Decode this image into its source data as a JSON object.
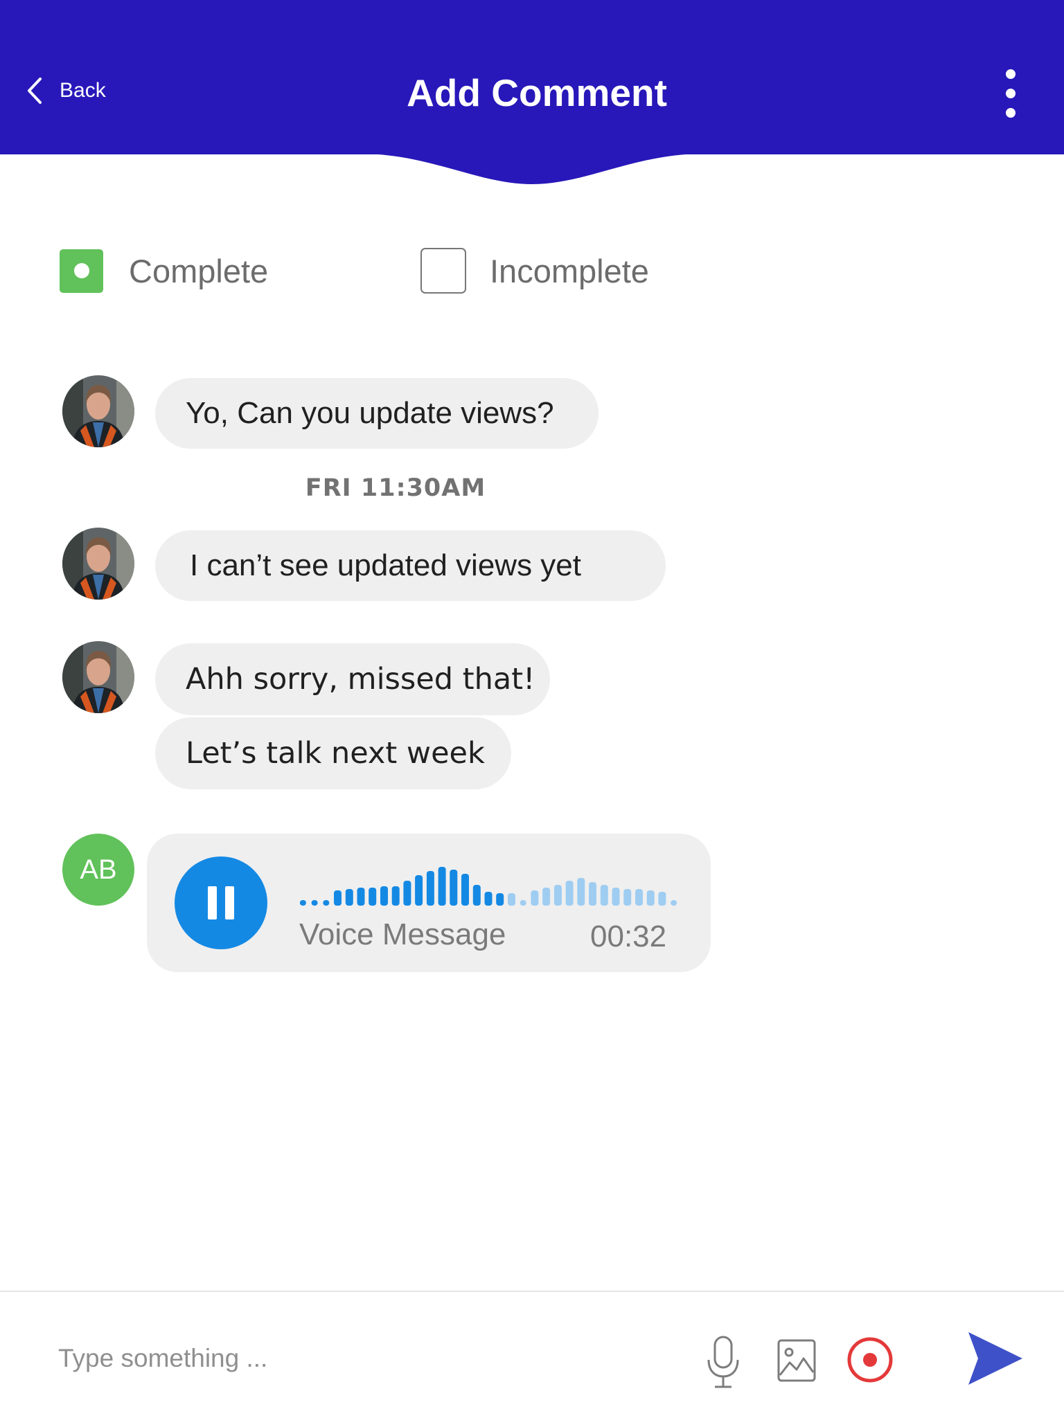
{
  "header": {
    "back_label": "Back",
    "title": "Add Comment",
    "color": "#2818b9"
  },
  "status": {
    "complete_label": "Complete",
    "incomplete_label": "Incomplete",
    "selected": "Complete"
  },
  "messages": [
    {
      "text": "Yo, Can you update views?"
    },
    {
      "timestamp": "FRI 11:30AM"
    },
    {
      "text": "I can’t see updated views yet"
    },
    {
      "text": "Ahh sorry, missed that!"
    },
    {
      "text": "Let’s talk next week"
    }
  ],
  "voice_message": {
    "sender_initials": "AB",
    "label": "Voice Message",
    "duration": "00:32",
    "state": "playing",
    "accent": "#1489e4"
  },
  "composer": {
    "placeholder": "Type something ...",
    "tools": [
      "microphone-icon",
      "image-icon",
      "record-icon",
      "send-icon"
    ]
  }
}
